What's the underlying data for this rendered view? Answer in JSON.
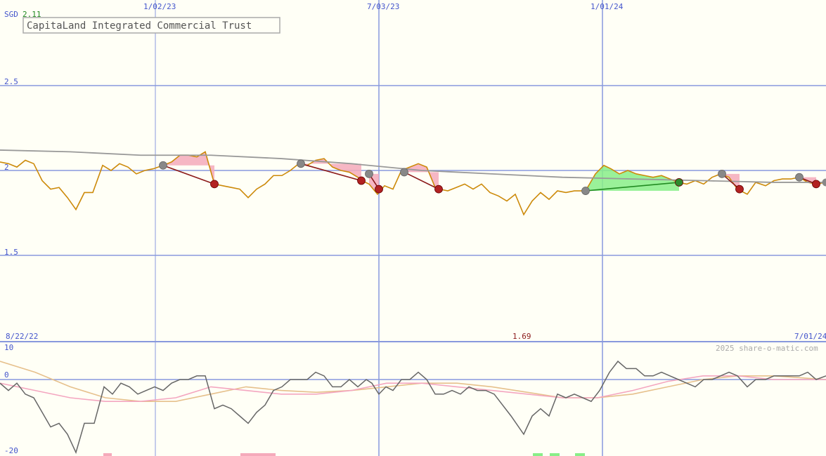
{
  "chart_data": [
    {
      "type": "line",
      "title": "CapitaLand Integrated Commercial Trust",
      "currency": "SGD",
      "last_price": "2.11",
      "low_marker": "1.69",
      "watermark": "2025 share-o-matic.com",
      "x_ticks": [
        "1/02/23",
        "7/03/23",
        "1/01/24"
      ],
      "x_range_labels": [
        "8/22/22",
        "7/01/24"
      ],
      "y_ticks": [
        "2.5",
        "2",
        "1.5"
      ],
      "ylim": [
        1.0,
        2.95
      ],
      "colors": {
        "price": "#cc8a0a",
        "avg": "#999999",
        "grid": "#8899dd",
        "profit": "#88ee88",
        "loss": "#f5aabb",
        "trade_loss": "#8b1a1a",
        "trade_win": "#228b22",
        "dot_loss": "#b22222",
        "dot_win": "#2e8b2e",
        "dot_entry": "#888888"
      },
      "series": [
        {
          "role": "price",
          "x": [
            0,
            12,
            24,
            36,
            48,
            60,
            72,
            84,
            96,
            108,
            120,
            132,
            146,
            158,
            170,
            182,
            194,
            206,
            218,
            232,
            244,
            256,
            268,
            280,
            292,
            305,
            317,
            329,
            341,
            353,
            365,
            377,
            389,
            401,
            413,
            425,
            437,
            449,
            461,
            473,
            485,
            497,
            509,
            515,
            525,
            537,
            547,
            559,
            571,
            583,
            595,
            607,
            619,
            625,
            637,
            649,
            661,
            673,
            685,
            697,
            709,
            721,
            733,
            745,
            757,
            769,
            781,
            793,
            805,
            817,
            833,
            847,
            859,
            869,
            881,
            893,
            905,
            917,
            929,
            941,
            953,
            965,
            977,
            989,
            1001,
            1013,
            1025,
            1037,
            1049,
            1063,
            1075,
            1089,
            1101,
            1113,
            1125,
            1137,
            1149,
            1161,
            1175
          ],
          "values": [
            2.05,
            2.04,
            2.02,
            2.06,
            2.04,
            1.94,
            1.89,
            1.9,
            1.84,
            1.77,
            1.87,
            1.87,
            2.03,
            2.0,
            2.04,
            2.02,
            1.98,
            2.0,
            2.01,
            2.03,
            2.05,
            2.09,
            2.09,
            2.08,
            2.11,
            1.92,
            1.91,
            1.9,
            1.89,
            1.84,
            1.89,
            1.92,
            1.97,
            1.97,
            2.0,
            2.04,
            2.03,
            2.06,
            2.07,
            2.02,
            2.0,
            1.99,
            1.96,
            1.94,
            1.92,
            1.86,
            1.91,
            1.89,
            2.0,
            2.02,
            2.04,
            2.02,
            1.9,
            1.89,
            1.88,
            1.9,
            1.92,
            1.89,
            1.92,
            1.87,
            1.85,
            1.82,
            1.86,
            1.74,
            1.82,
            1.87,
            1.83,
            1.88,
            1.87,
            1.88,
            1.88,
            1.98,
            2.03,
            2.01,
            1.98,
            2.0,
            1.98,
            1.97,
            1.96,
            1.97,
            1.95,
            1.93,
            1.92,
            1.94,
            1.92,
            1.96,
            1.98,
            1.96,
            1.89,
            1.86,
            1.93,
            1.91,
            1.94,
            1.95,
            1.95,
            1.96,
            1.93,
            1.92,
            1.93
          ]
        },
        {
          "role": "moving-average",
          "x": [
            0,
            100,
            200,
            300,
            400,
            500,
            600,
            700,
            800,
            900,
            1000,
            1100,
            1175
          ],
          "values": [
            2.12,
            2.11,
            2.09,
            2.09,
            2.07,
            2.04,
            2.0,
            1.98,
            1.96,
            1.95,
            1.94,
            1.93,
            1.93
          ]
        }
      ],
      "trades": [
        {
          "x0": 232,
          "y0": 2.03,
          "x1": 305,
          "y1": 1.92,
          "result": "loss"
        },
        {
          "x0": 428,
          "y0": 2.04,
          "x1": 514,
          "y1": 1.94,
          "result": "loss"
        },
        {
          "x0": 525,
          "y0": 1.98,
          "x1": 539,
          "y1": 1.89,
          "result": "loss"
        },
        {
          "x0": 575,
          "y0": 1.99,
          "x1": 624,
          "y1": 1.89,
          "result": "loss"
        },
        {
          "x0": 833,
          "y0": 1.88,
          "x1": 966,
          "y1": 1.93,
          "result": "win"
        },
        {
          "x0": 1027,
          "y0": 1.98,
          "x1": 1052,
          "y1": 1.89,
          "result": "loss"
        },
        {
          "x0": 1137,
          "y0": 1.96,
          "x1": 1161,
          "y1": 1.92,
          "result": "loss"
        }
      ],
      "entry_dots": [
        1175
      ]
    },
    {
      "type": "line",
      "title": "",
      "y_ticks": [
        "10",
        "0",
        "-20"
      ],
      "ylim": [
        -20,
        10
      ],
      "series": [
        {
          "role": "oscillator",
          "color": "#666666",
          "x": [
            0,
            12,
            24,
            36,
            48,
            60,
            72,
            84,
            96,
            108,
            120,
            134,
            148,
            160,
            172,
            184,
            196,
            208,
            220,
            232,
            244,
            256,
            268,
            280,
            292,
            305,
            317,
            329,
            341,
            353,
            365,
            377,
            389,
            401,
            413,
            425,
            437,
            449,
            461,
            473,
            485,
            497,
            509,
            521,
            529,
            539,
            549,
            559,
            571,
            583,
            595,
            607,
            619,
            631,
            643,
            655,
            667,
            679,
            691,
            703,
            715,
            727,
            745,
            757,
            769,
            781,
            793,
            805,
            817,
            829,
            841,
            853,
            867,
            879,
            891,
            905,
            917,
            929,
            941,
            953,
            965,
            977,
            989,
            1001,
            1013,
            1025,
            1037,
            1049,
            1063,
            1075,
            1089,
            1101,
            1113,
            1125,
            1137,
            1149,
            1161,
            1175
          ],
          "values": [
            -1,
            -3,
            -1,
            -4,
            -5,
            -9,
            -13,
            -12,
            -15,
            -20,
            -12,
            -12,
            -2,
            -4,
            -1,
            -2,
            -4,
            -3,
            -2,
            -3,
            -1,
            0,
            0,
            1,
            1,
            -8,
            -7,
            -8,
            -10,
            -12,
            -9,
            -7,
            -3,
            -2,
            0,
            0,
            0,
            2,
            1,
            -2,
            -2,
            0,
            -2,
            0,
            -1,
            -4,
            -2,
            -3,
            0,
            0,
            2,
            0,
            -4,
            -4,
            -3,
            -4,
            -2,
            -3,
            -3,
            -4,
            -7,
            -10,
            -15,
            -10,
            -8,
            -10,
            -4,
            -5,
            -4,
            -5,
            -6,
            -3,
            2,
            5,
            3,
            3,
            1,
            1,
            2,
            1,
            0,
            -1,
            -2,
            0,
            0,
            1,
            2,
            1,
            -2,
            0,
            0,
            1,
            1,
            1,
            1,
            2,
            0,
            1
          ]
        },
        {
          "role": "signal-pink",
          "color": "#f4a6c0",
          "x": [
            0,
            50,
            100,
            150,
            200,
            250,
            300,
            350,
            400,
            450,
            500,
            550,
            600,
            650,
            700,
            750,
            800,
            850,
            900,
            950,
            1000,
            1050,
            1100,
            1175
          ],
          "values": [
            -1,
            -3,
            -5,
            -6,
            -6,
            -5,
            -2,
            -3,
            -4,
            -4,
            -3,
            -1,
            -1,
            -2,
            -3,
            -4,
            -5,
            -5,
            -3,
            -0.5,
            1,
            1,
            0,
            0
          ]
        },
        {
          "role": "signal-tan",
          "color": "#e6c08c",
          "x": [
            0,
            50,
            100,
            150,
            200,
            250,
            300,
            350,
            400,
            450,
            500,
            550,
            600,
            650,
            700,
            750,
            800,
            850,
            900,
            950,
            1000,
            1050,
            1100,
            1175
          ],
          "values": [
            5,
            2,
            -2,
            -5,
            -6,
            -6,
            -4,
            -2,
            -3,
            -3.5,
            -3,
            -2,
            -1,
            -1,
            -2,
            -3.5,
            -5,
            -5,
            -4,
            -2,
            0,
            1,
            1,
            0
          ]
        }
      ],
      "bottom_markers": [
        {
          "x": 147,
          "w": 12,
          "result": "loss"
        },
        {
          "x": 342,
          "w": 50,
          "result": "loss"
        },
        {
          "x": 758,
          "w": 14,
          "result": "win"
        },
        {
          "x": 782,
          "w": 14,
          "result": "win"
        },
        {
          "x": 818,
          "w": 14,
          "result": "win"
        }
      ]
    }
  ]
}
